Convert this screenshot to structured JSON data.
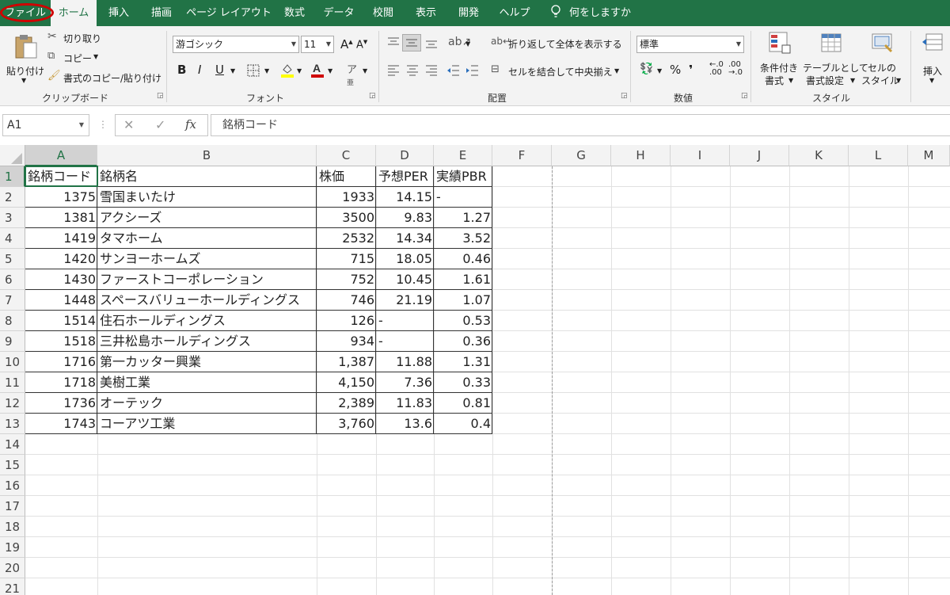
{
  "tabs": [
    "ファイル",
    "ホーム",
    "挿入",
    "描画",
    "ページ レイアウト",
    "数式",
    "データ",
    "校閲",
    "表示",
    "開発",
    "ヘルプ"
  ],
  "tell_me": "何をしますか",
  "ribbon": {
    "clipboard": {
      "paste": "貼り付け",
      "cut": "切り取り",
      "copy": "コピー",
      "format_painter": "書式のコピー/貼り付け",
      "label": "クリップボード"
    },
    "font": {
      "name": "游ゴシック",
      "size": "11",
      "bold": "B",
      "italic": "I",
      "underline": "U",
      "label": "フォント",
      "font_color": "#d00000",
      "fill_color": "#ffff00"
    },
    "alignment": {
      "wrap_text": "折り返して全体を表示する",
      "merge_center": "セルを結合して中央揃え",
      "label": "配置"
    },
    "number": {
      "format": "標準",
      "percent": "%",
      "comma": "❜",
      "inc_decimal": ".00",
      "dec_decimal": ".0",
      "label": "数値"
    },
    "styles": {
      "conditional": [
        "条件付き",
        "書式"
      ],
      "table": [
        "テーブルとして",
        "書式設定"
      ],
      "cell": [
        "セルの",
        "スタイル"
      ],
      "label": "スタイル"
    },
    "cells": {
      "insert": "挿入"
    }
  },
  "formula_bar": {
    "name_box": "A1",
    "fx": "fx",
    "content": "銘柄コード"
  },
  "columns": [
    "A",
    "B",
    "C",
    "D",
    "E",
    "F",
    "G",
    "H",
    "I",
    "J",
    "K",
    "L",
    "M"
  ],
  "rows": [
    "1",
    "2",
    "3",
    "4",
    "5",
    "6",
    "7",
    "8",
    "9",
    "10",
    "11",
    "12",
    "13",
    "14",
    "15",
    "16",
    "17",
    "18",
    "19",
    "20",
    "21"
  ],
  "sheet": {
    "header": [
      "銘柄コード",
      "銘柄名",
      "株価",
      "予想PER",
      "実績PBR"
    ],
    "data": [
      [
        "1375",
        "雪国まいたけ",
        "1933",
        "14.15",
        "-"
      ],
      [
        "1381",
        "アクシーズ",
        "3500",
        "9.83",
        "1.27"
      ],
      [
        "1419",
        "タマホーム",
        "2532",
        "14.34",
        "3.52"
      ],
      [
        "1420",
        "サンヨーホームズ",
        "715",
        "18.05",
        "0.46"
      ],
      [
        "1430",
        "ファーストコーポレーション",
        "752",
        "10.45",
        "1.61"
      ],
      [
        "1448",
        "スペースバリューホールディングス",
        "746",
        "21.19",
        "1.07"
      ],
      [
        "1514",
        "住石ホールディングス",
        "126",
        "-",
        "0.53"
      ],
      [
        "1518",
        "三井松島ホールディングス",
        "934",
        "-",
        "0.36"
      ],
      [
        "1716",
        "第一カッター興業",
        "1,387",
        "11.88",
        "1.31"
      ],
      [
        "1718",
        "美樹工業",
        "4,150",
        "7.36",
        "0.33"
      ],
      [
        "1736",
        "オーテック",
        "2,389",
        "11.83",
        "0.81"
      ],
      [
        "1743",
        "コーアツ工業",
        "3,760",
        "13.6",
        "0.4"
      ]
    ]
  },
  "colors": {
    "brand": "#217346",
    "highlight_circle": "#d00000"
  }
}
